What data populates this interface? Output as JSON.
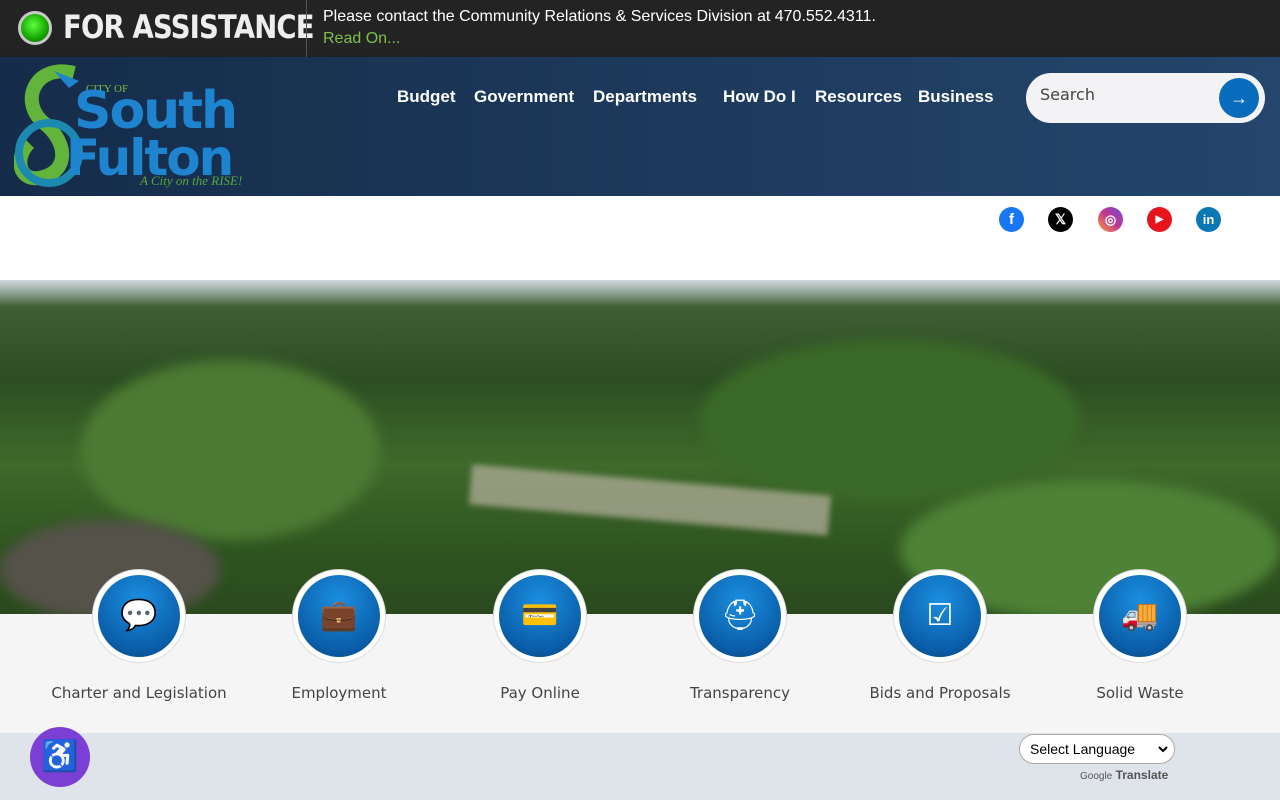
{
  "alert": {
    "title": "FOR ASSISTANCE",
    "message": "Please contact the Community Relations & Services Division at 470.552.4311.",
    "link": "Read On..."
  },
  "logo": {
    "city_of": "CITY OF",
    "south": "South",
    "fulton": "Fulton",
    "tagline": "A City on the RISE!"
  },
  "nav": [
    "Budget",
    "Government",
    "Departments",
    "How Do I",
    "Resources",
    "Business"
  ],
  "search": {
    "placeholder": "Search",
    "button_icon": "arrow-right-icon"
  },
  "social": [
    "facebook",
    "x",
    "instagram",
    "youtube",
    "linkedin"
  ],
  "tiles": [
    {
      "label": "Charter and Legislation",
      "icon": "chat-icon"
    },
    {
      "label": "Employment",
      "icon": "briefcase-icon"
    },
    {
      "label": "Pay Online",
      "icon": "credit-card-icon"
    },
    {
      "label": "Transparency",
      "icon": "hard-hat-icon"
    },
    {
      "label": "Bids and Proposals",
      "icon": "checklist-icon"
    },
    {
      "label": "Solid Waste",
      "icon": "garbage-truck-icon"
    }
  ],
  "translate": {
    "select": "Select Language",
    "google": "Google",
    "translate": "Translate"
  },
  "colors": {
    "accent": "#0a6cbd",
    "header": "#1e3a5f",
    "alert_bg": "#232323"
  }
}
